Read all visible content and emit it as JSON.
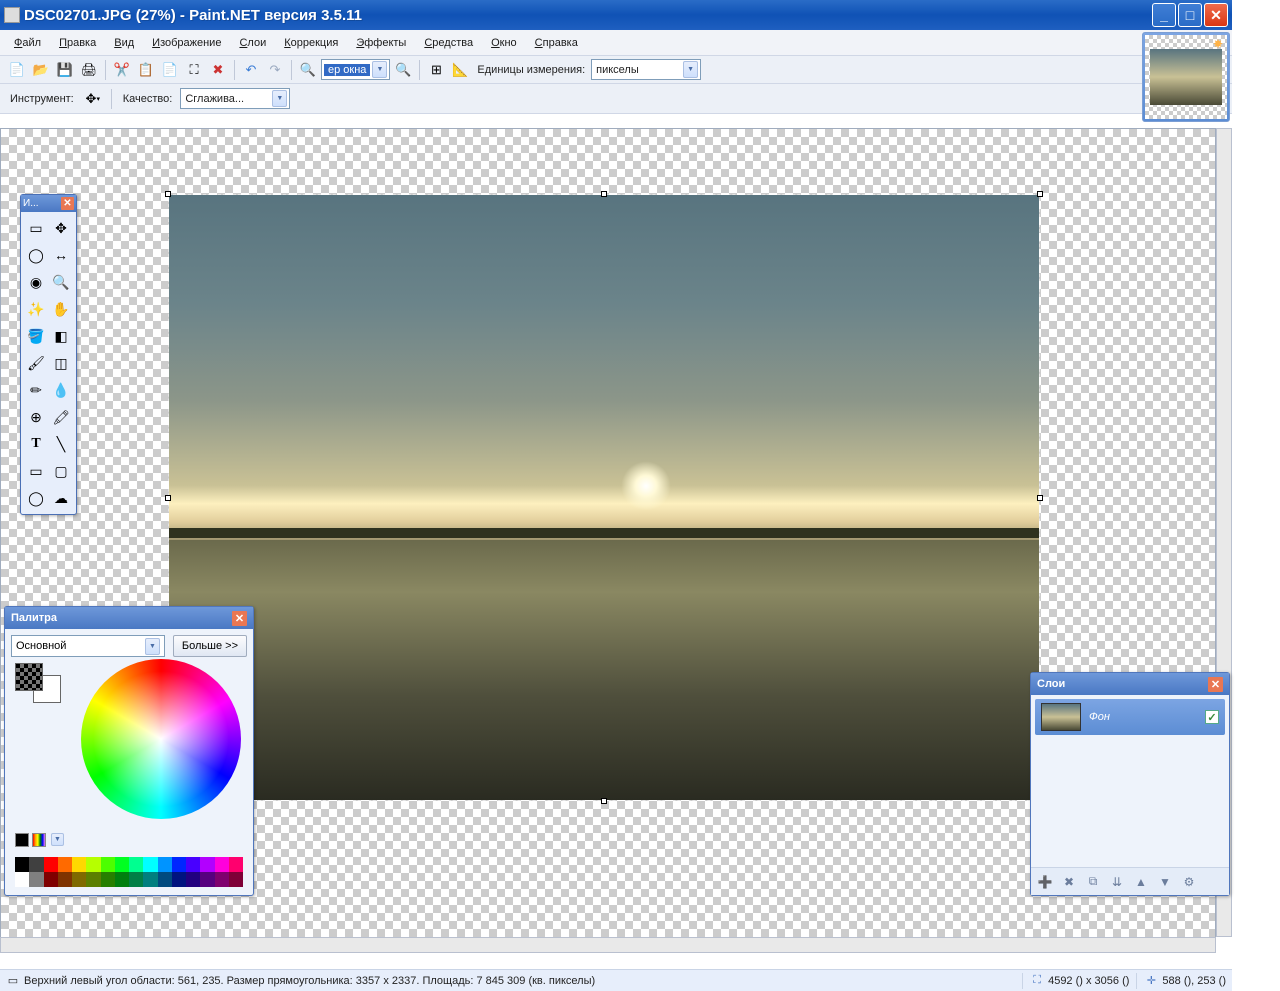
{
  "window_title": "DSC02701.JPG (27%) - Paint.NET версия 3.5.11",
  "menu": {
    "file": "Файл",
    "edit": "Правка",
    "view": "Вид",
    "image": "Изображение",
    "layers": "Слои",
    "adjust": "Коррекция",
    "effects": "Эффекты",
    "tools": "Средства",
    "window": "Окно",
    "help": "Справка"
  },
  "toolbar1": {
    "zoom_combo_value": "ер окна",
    "units_label": "Единицы измерения:",
    "units_value": "пикселы"
  },
  "toolbar2": {
    "instrument_label": "Инструмент:",
    "quality_label": "Качество:",
    "quality_value": "Сглажива..."
  },
  "tools_panel": {
    "title": "И..."
  },
  "colors_panel": {
    "title": "Палитра",
    "combo_value": "Основной",
    "more_label": "Больше >>"
  },
  "layers_panel": {
    "title": "Слои",
    "layer0_name": "Фон"
  },
  "status": {
    "selection_text": "Верхний левый угол области: 561, 235. Размер прямоугольника: 3357 x 2337. Площадь: 7 845 309 (кв. пикселы)",
    "dims_text": "4592 () x 3056 ()",
    "pos_text": "588 (), 253 ()"
  },
  "palette_colors_row1": [
    "#000",
    "#404040",
    "#ff0000",
    "#ff6a00",
    "#ffd800",
    "#b6ff00",
    "#4cff00",
    "#00ff21",
    "#00ff90",
    "#00ffff",
    "#0094ff",
    "#0026ff",
    "#4800ff",
    "#b200ff",
    "#ff00dc",
    "#ff006e"
  ],
  "palette_colors_row2": [
    "#fff",
    "#808080",
    "#7f0000",
    "#7f3300",
    "#7f6a00",
    "#5b7f00",
    "#267f00",
    "#007f0e",
    "#007f46",
    "#007f7f",
    "#004a7f",
    "#00137f",
    "#21007f",
    "#57007f",
    "#7f006e",
    "#7f0037"
  ]
}
